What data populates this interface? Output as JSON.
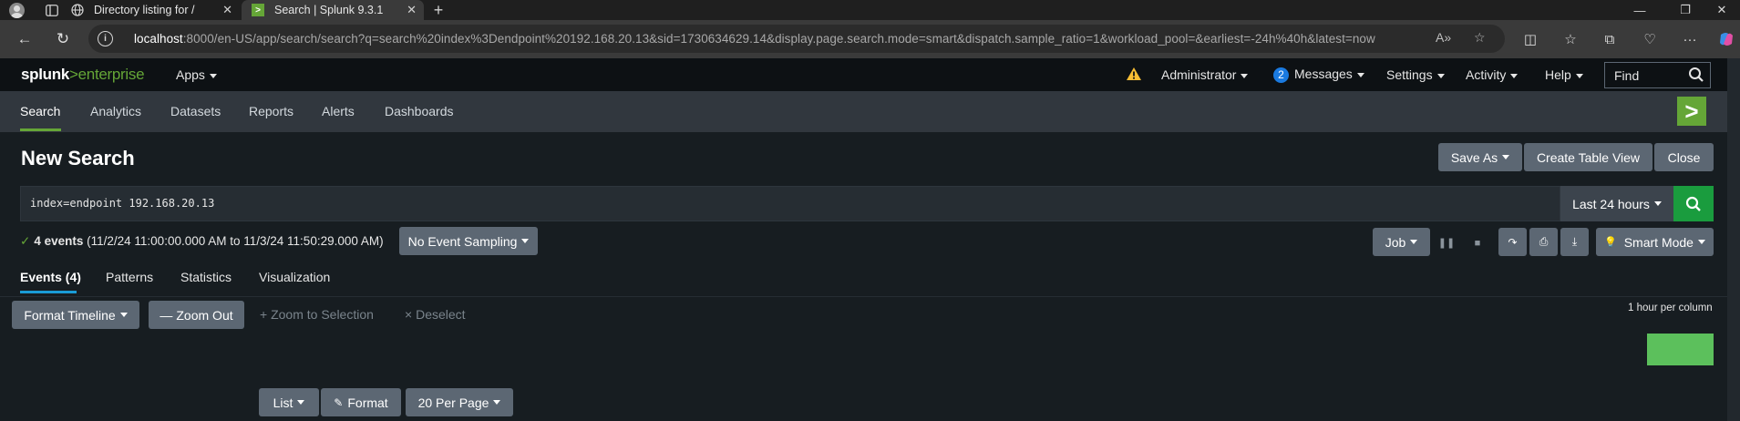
{
  "browser": {
    "tabs": [
      {
        "title": "Directory listing for /",
        "icon": "globe-icon",
        "active": false
      },
      {
        "title": "Search | Splunk 9.3.1",
        "icon": "splunk-favicon",
        "active": true
      }
    ],
    "new_tab_glyph": "+",
    "url": {
      "host": "localhost",
      "rest": ":8000/en-US/app/search/search?q=search%20index%3Dendpoint%20192.168.20.13&sid=1730634629.14&display.page.search.mode=smart&dispatch.sample_ratio=1&workload_pool=&earliest=-24h%40h&latest=now"
    }
  },
  "header": {
    "logo": {
      "brand": "splunk",
      "sep": ">",
      "product": "enterprise"
    },
    "apps_label": "Apps",
    "user_label": "Administrator",
    "messages_count": "2",
    "messages_label": "Messages",
    "settings_label": "Settings",
    "activity_label": "Activity",
    "help_label": "Help",
    "find_placeholder": "Find"
  },
  "appbar": {
    "tabs": [
      "Search",
      "Analytics",
      "Datasets",
      "Reports",
      "Alerts",
      "Dashboards"
    ],
    "active_tab": "Search"
  },
  "search": {
    "title": "New Search",
    "save_as_label": "Save As",
    "create_table_label": "Create Table View",
    "close_label": "Close",
    "query": "index=endpoint 192.168.20.13",
    "time_range": "Last 24 hours",
    "status_count": "4 events",
    "status_range": "(11/2/24 11:00:00.000 AM to 11/3/24 11:50:29.000 AM)",
    "sampling_label": "No Event Sampling",
    "job_label": "Job",
    "mode_label": "Smart Mode"
  },
  "results": {
    "tabs": [
      "Events (4)",
      "Patterns",
      "Statistics",
      "Visualization"
    ],
    "active_tab": "Events (4)",
    "format_timeline_label": "Format Timeline",
    "zoom_out_label": "Zoom Out",
    "zoom_selection_label": "Zoom to Selection",
    "deselect_label": "Deselect",
    "per_column_label": "1 hour per column",
    "list_label": "List",
    "format_label": "Format",
    "per_page_label": "20 Per Page"
  },
  "colors": {
    "accent_green": "#65a637",
    "search_green": "#1a9c3e",
    "tab_blue": "#1a9cd6",
    "timeline_bar": "#5cc05c"
  }
}
